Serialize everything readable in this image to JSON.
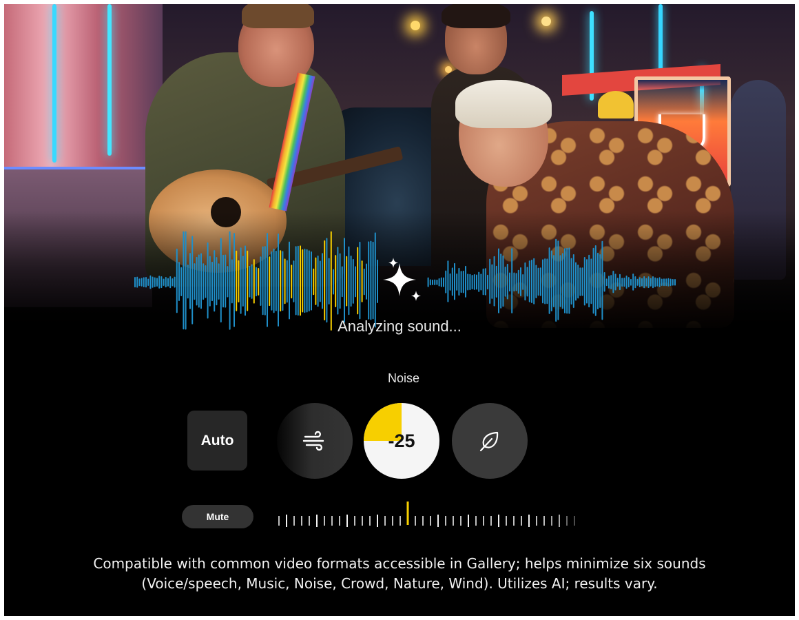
{
  "status": {
    "text": "Analyzing sound..."
  },
  "controls": {
    "section_label": "Noise",
    "auto_label": "Auto",
    "buttons": [
      {
        "icon": "wind-icon"
      },
      {
        "icon": "noise-dial"
      },
      {
        "icon": "leaf-icon"
      }
    ],
    "noise_value": "-25",
    "noise_level_fraction": 0.25,
    "mute_label": "Mute",
    "slider": {
      "ticks": 40,
      "selected_tick": 17
    }
  },
  "disclaimer": {
    "line1": "Compatible with common video formats accessible in Gallery; helps minimize six sounds",
    "line2": "(Voice/speech, Music, Noise, Crowd, Nature, Wind). Utilizes AI; results vary."
  },
  "colors": {
    "accent_yellow": "#f7cf00",
    "wave_blue": "#1f8fc9",
    "background": "#000000",
    "button_dark": "#272727"
  },
  "icons": [
    "ai-sparkle-icon",
    "wind-icon",
    "leaf-icon"
  ]
}
